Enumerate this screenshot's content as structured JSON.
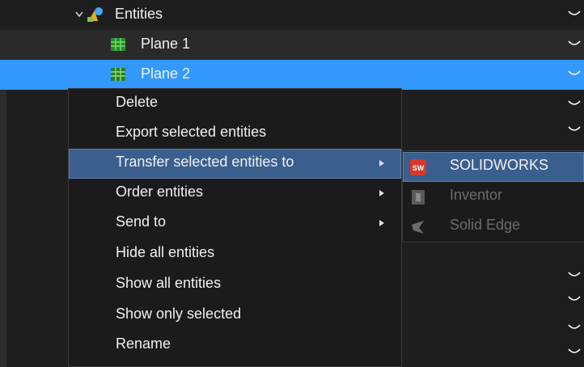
{
  "tree": {
    "entities_label": "Entities",
    "plane1_label": "Plane 1",
    "plane2_label": "Plane 2"
  },
  "context_menu": {
    "items": [
      {
        "label": "Delete",
        "has_submenu": false
      },
      {
        "label": "Export selected entities",
        "has_submenu": false
      },
      {
        "label": "Transfer selected entities to",
        "has_submenu": true,
        "highlighted": true
      },
      {
        "label": "Order entities",
        "has_submenu": true
      },
      {
        "label": "Send to",
        "has_submenu": true
      },
      {
        "label": "Hide all entities",
        "has_submenu": false
      },
      {
        "label": "Show all entities",
        "has_submenu": false
      },
      {
        "label": "Show only selected",
        "has_submenu": false
      },
      {
        "label": "Rename",
        "has_submenu": false
      }
    ]
  },
  "transfer_submenu": {
    "items": [
      {
        "label": "SOLIDWORKS",
        "enabled": true,
        "icon": "solidworks-icon"
      },
      {
        "label": "Inventor",
        "enabled": false,
        "icon": "inventor-icon"
      },
      {
        "label": "Solid Edge",
        "enabled": false,
        "icon": "solid-edge-icon"
      }
    ]
  },
  "colors": {
    "selection": "#3399ff",
    "menu_highlight": "#3a5f8f",
    "menu_background": "#1b1b1b",
    "disabled_text": "#6c6c6c"
  }
}
